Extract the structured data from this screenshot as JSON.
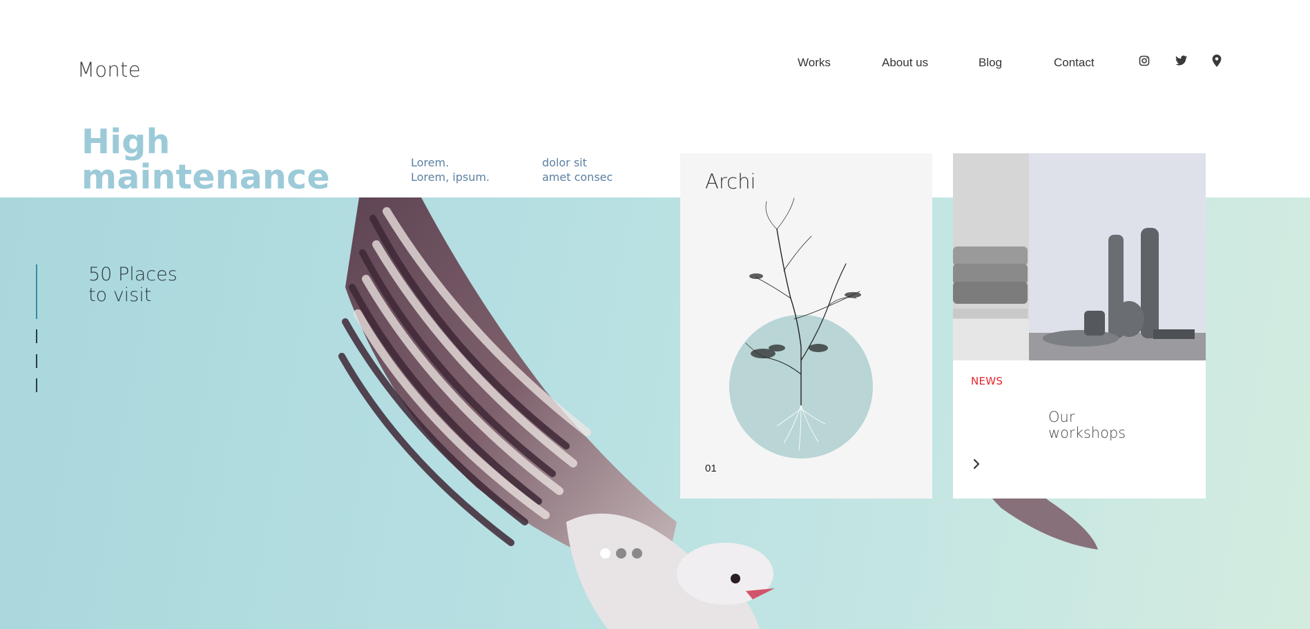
{
  "brand": {
    "name": "Monte"
  },
  "nav": {
    "items": [
      {
        "label": "Works"
      },
      {
        "label": "About us"
      },
      {
        "label": "Blog"
      },
      {
        "label": "Contact"
      }
    ],
    "social_icons": [
      "instagram-icon",
      "twitter-icon",
      "location-pin-icon"
    ]
  },
  "hero": {
    "title_line1": "High",
    "title_line2": "maintenance",
    "lorem_col1": [
      "Lorem.",
      "Lorem, ipsum."
    ],
    "lorem_col2": [
      "dolor sit",
      "amet consec"
    ],
    "side_caption_line1": "50 Places",
    "side_caption_line2": "to visit"
  },
  "card_archi": {
    "title": "Archi",
    "number": "01"
  },
  "card_news": {
    "label": "NEWS",
    "title_line1": "Our",
    "title_line2": "workshops"
  },
  "slider": {
    "dots": 3,
    "active_index": 0
  },
  "colors": {
    "accent_title": "#9ccad8",
    "news_red": "#e3262c",
    "sky": "#b6dfe2",
    "circle": "#b9d5d6"
  }
}
